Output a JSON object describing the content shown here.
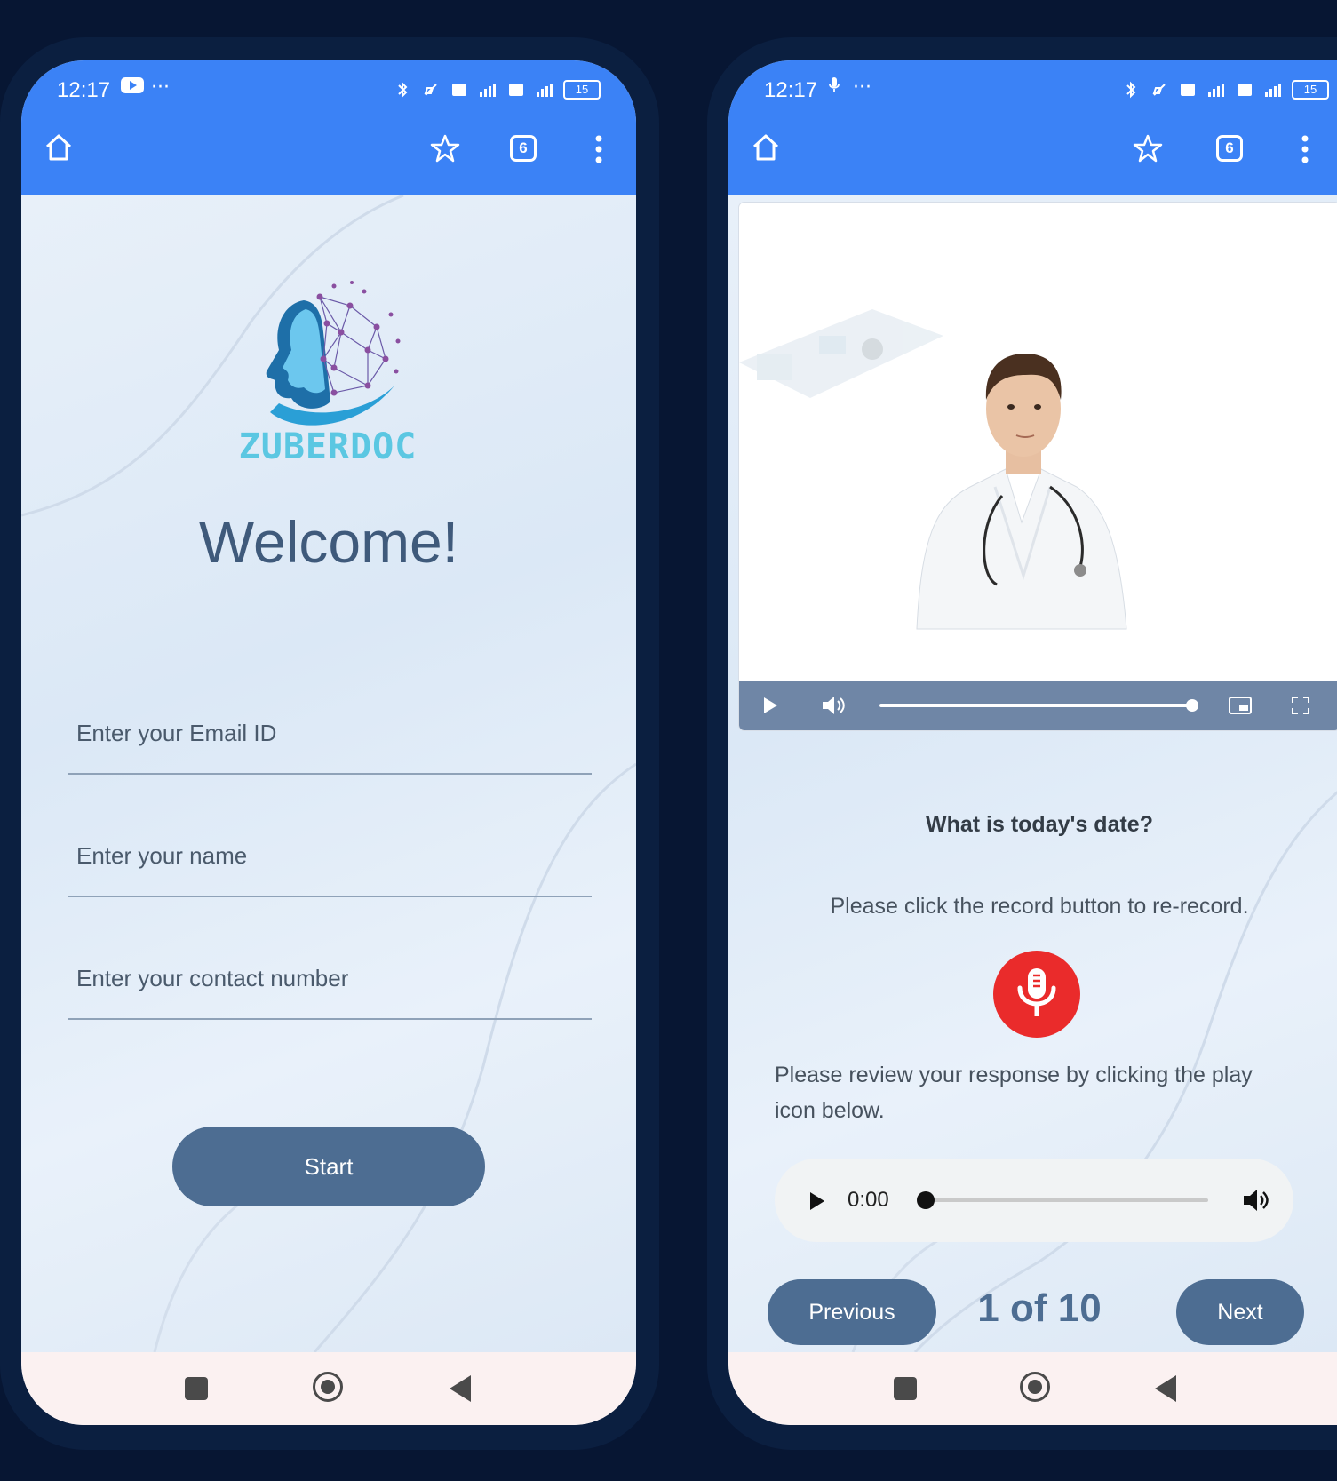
{
  "colors": {
    "topbar": "#3b82f6",
    "primary_button": "#4d6d92",
    "record_button": "#ea2b2b",
    "logo_text": "#5bc7e2"
  },
  "status_bar": {
    "time": "12:17",
    "extra": "···",
    "battery": "15",
    "tab_count": "6"
  },
  "login_screen": {
    "logo_text": "ZUBERDOC",
    "heading": "Welcome!",
    "email_placeholder": "Enter your Email ID",
    "name_placeholder": "Enter your name",
    "contact_placeholder": "Enter your contact number",
    "start_label": "Start"
  },
  "question_screen": {
    "video": {
      "progress": 1.0
    },
    "question": "What is today's date?",
    "rerecord_text": "Please click the record button to re-record.",
    "review_text": "Please review your response by clicking the play icon below.",
    "audio": {
      "time": "0:00",
      "progress": 0.0
    },
    "previous_label": "Previous",
    "counter": "1 of 10",
    "next_label": "Next"
  }
}
